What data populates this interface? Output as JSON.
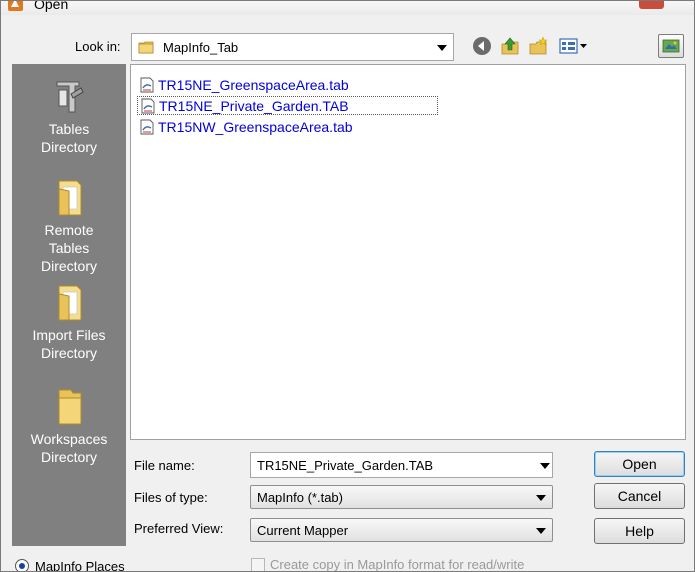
{
  "window": {
    "title": "Open"
  },
  "toolbar": {
    "look_in_label": "Look in:",
    "look_in_value": "MapInfo_Tab",
    "icons": [
      "back-arrow-icon",
      "up-folder-icon",
      "new-folder-icon",
      "views-menu-icon",
      "workspace-icon"
    ]
  },
  "places": [
    {
      "id": "tables",
      "line1": "Tables",
      "line2": "Directory",
      "line3": "",
      "icon": "table-ruler-icon"
    },
    {
      "id": "remote",
      "line1": "Remote",
      "line2": "Tables",
      "line3": "Directory",
      "icon": "folder-icon"
    },
    {
      "id": "import",
      "line1": "Import Files",
      "line2": "Directory",
      "line3": "",
      "icon": "folder-icon"
    },
    {
      "id": "workspaces",
      "line1": "Workspaces",
      "line2": "Directory",
      "line3": "",
      "icon": "folder-icon"
    }
  ],
  "files": [
    {
      "name": "TR15NE_GreenspaceArea.tab",
      "selected": false
    },
    {
      "name": "TR15NE_Private_Garden.TAB",
      "selected": true
    },
    {
      "name": "TR15NW_GreenspaceArea.tab",
      "selected": false
    }
  ],
  "form": {
    "file_name_label": "File name:",
    "file_name_value": "TR15NE_Private_Garden.TAB",
    "files_of_type_label": "Files of type:",
    "files_of_type_value": "MapInfo (*.tab)",
    "preferred_view_label": "Preferred View:",
    "preferred_view_value": "Current Mapper"
  },
  "buttons": {
    "open": "Open",
    "cancel": "Cancel",
    "help": "Help"
  },
  "bottom": {
    "places_radio_label": "MapInfo Places",
    "copy_checkbox_label": "Create copy in MapInfo format for read/write"
  },
  "colors": {
    "places_bar": "#808080",
    "file_link": "#0000e0",
    "selection_border": "#5a5a5a"
  }
}
